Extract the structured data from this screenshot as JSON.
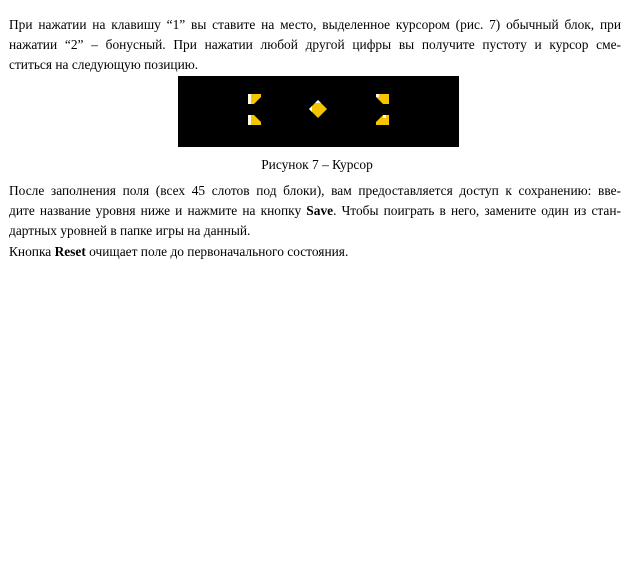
{
  "paragraph1": {
    "line1": "При нажатии на клавишу “1” вы ставите на место, выделенное курсором (рис. 7) обычный блок, при",
    "line2": "нажатии “2” – бонусный. При нажатии любой другой цифры вы получите пустоту и курсор сме-",
    "line3": "ститься на следующую позицию."
  },
  "figure": {
    "caption": "Рисунок 7 – Курсор",
    "background": "#000000",
    "accent": "#f5c400",
    "highlight": "#ffffff"
  },
  "paragraph2": {
    "line1": "После заполнения поля (всех 45 слотов под блоки), вам предоставляется доступ к сохранению: вве-",
    "line2_before": "дите название уровня ниже и нажмите на кнопку ",
    "line2_bold": "Save",
    "line2_after": ". Чтобы поиграть в него, замените один из стан-",
    "line3": "дартных уровней в папке игры на данный."
  },
  "paragraph3": {
    "before": "Кнопка ",
    "bold": "Reset",
    "after": " очищает поле до первоначального состояния."
  }
}
